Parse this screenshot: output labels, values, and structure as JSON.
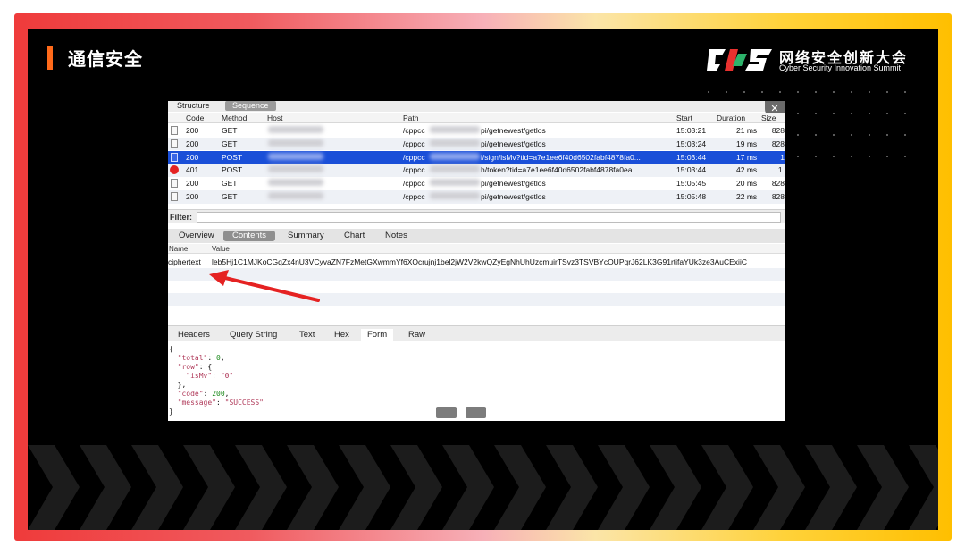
{
  "slide": {
    "title": "通信安全",
    "logo_cn": "网络安全创新大会",
    "logo_en": "Cyber Security Innovation Summit",
    "accent_color": "#ff6a1a"
  },
  "app": {
    "view_tabs": [
      "Structure",
      "Sequence"
    ],
    "active_view_tab": "Sequence",
    "close_icon": "close-icon",
    "columns": {
      "code": "Code",
      "method": "Method",
      "host": "Host",
      "path": "Path",
      "start": "Start",
      "duration": "Duration",
      "size": "Size"
    },
    "requests": [
      {
        "code": "200",
        "method": "GET",
        "path_pre": "/cppcc",
        "path_post": "pi/getnewest/getlos",
        "start": "15:03:21",
        "duration": "21 ms",
        "size": "828",
        "icon": "document-icon",
        "selected": false
      },
      {
        "code": "200",
        "method": "GET",
        "path_pre": "/cppcc",
        "path_post": "pi/getnewest/getlos",
        "start": "15:03:24",
        "duration": "19 ms",
        "size": "828",
        "icon": "document-icon",
        "selected": false
      },
      {
        "code": "200",
        "method": "POST",
        "path_pre": "/cppcc",
        "path_post": "i/sign/isMv?tid=a7e1ee6f40d6502fabf4878fa0...",
        "start": "15:03:44",
        "duration": "17 ms",
        "size": "1",
        "icon": "document-icon",
        "selected": true
      },
      {
        "code": "401",
        "method": "POST",
        "path_pre": "/cppcc",
        "path_post": "h/token?tid=a7e1ee6f40d6502fabf4878fa0ea...",
        "start": "15:03:44",
        "duration": "42 ms",
        "size": "1.",
        "icon": "error-icon",
        "selected": false
      },
      {
        "code": "200",
        "method": "GET",
        "path_pre": "/cppcc",
        "path_post": "pi/getnewest/getlos",
        "start": "15:05:45",
        "duration": "20 ms",
        "size": "828",
        "icon": "document-icon",
        "selected": false
      },
      {
        "code": "200",
        "method": "GET",
        "path_pre": "/cppcc",
        "path_post": "pi/getnewest/getlos",
        "start": "15:05:48",
        "duration": "22 ms",
        "size": "828",
        "icon": "document-icon",
        "selected": false
      }
    ],
    "filter_label": "Filter:",
    "filter_value": "",
    "detail_tabs": [
      "Overview",
      "Contents",
      "Summary",
      "Chart",
      "Notes"
    ],
    "active_detail_tab": "Contents",
    "nv_columns": {
      "name": "Name",
      "value": "Value"
    },
    "param": {
      "name": "ciphertext",
      "value": "leb5Hj1C1MJKoCGqZx4nU3VCyvaZN7FzMetGXwmmYf6XOcrujnj1bel2jW2V2kwQZyEgNhUhUzcmuirTSvz3TSVBYcOUPqrJ62LK3G91rtifaYUk3ze3AuCExiiC"
    },
    "response_tabs": [
      "Headers",
      "Query String",
      "Text",
      "Hex",
      "Form",
      "Raw"
    ],
    "active_response_tab": "Form",
    "json_lines": [
      [
        {
          "t": "{",
          "c": ""
        }
      ],
      [
        {
          "t": "  ",
          "c": ""
        },
        {
          "t": "\"total\"",
          "c": "k"
        },
        {
          "t": ": ",
          "c": ""
        },
        {
          "t": "0",
          "c": "n"
        },
        {
          "t": ",",
          "c": ""
        }
      ],
      [
        {
          "t": "  ",
          "c": ""
        },
        {
          "t": "\"row\"",
          "c": "k"
        },
        {
          "t": ": {",
          "c": ""
        }
      ],
      [
        {
          "t": "    ",
          "c": ""
        },
        {
          "t": "\"isMv\"",
          "c": "k"
        },
        {
          "t": ": ",
          "c": ""
        },
        {
          "t": "\"0\"",
          "c": "s"
        }
      ],
      [
        {
          "t": "  },",
          "c": ""
        }
      ],
      [
        {
          "t": "  ",
          "c": ""
        },
        {
          "t": "\"code\"",
          "c": "k"
        },
        {
          "t": ": ",
          "c": ""
        },
        {
          "t": "200",
          "c": "n"
        },
        {
          "t": ",",
          "c": ""
        }
      ],
      [
        {
          "t": "  ",
          "c": ""
        },
        {
          "t": "\"message\"",
          "c": "k"
        },
        {
          "t": ": ",
          "c": ""
        },
        {
          "t": "\"SUCCESS\"",
          "c": "s"
        }
      ],
      [
        {
          "t": "}",
          "c": ""
        }
      ]
    ]
  }
}
